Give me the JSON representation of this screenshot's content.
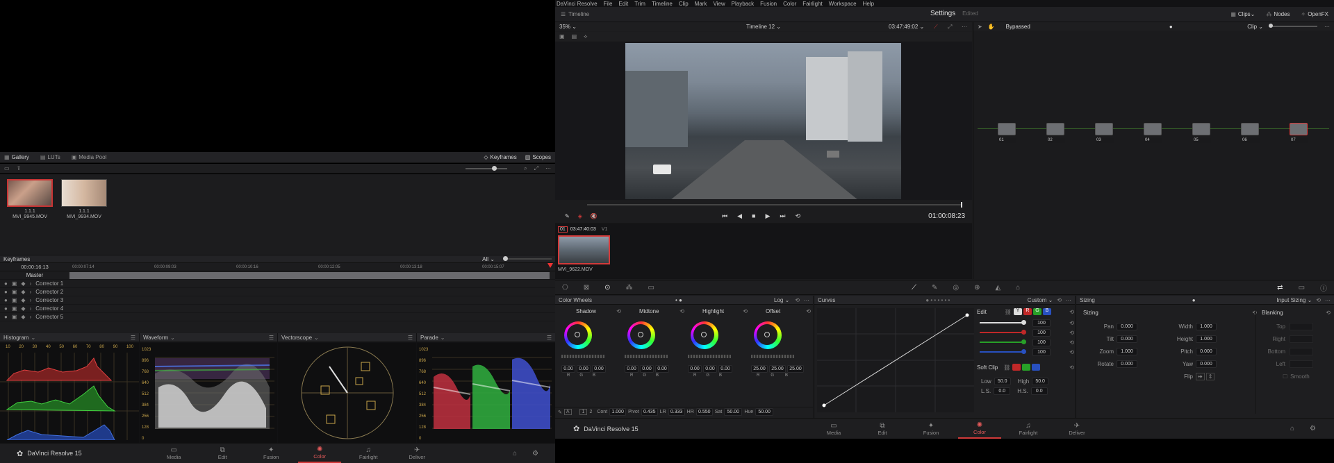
{
  "menu": {
    "items": [
      "DaVinci Resolve",
      "File",
      "Edit",
      "Trim",
      "Timeline",
      "Clip",
      "Mark",
      "View",
      "Playback",
      "Fusion",
      "Color",
      "Fairlight",
      "Workspace",
      "Help"
    ]
  },
  "header": {
    "timeline_label": "Timeline",
    "title": "Settings",
    "status": "Edited",
    "clips_label": "Clips",
    "nodes_label": "Nodes",
    "openfx_label": "OpenFX"
  },
  "viewer": {
    "zoom": "35%",
    "timeline_name": "Timeline 12",
    "timecode_top": "03:47:49:02",
    "timecode": "01:00:08:23"
  },
  "node_editor": {
    "status": "Bypassed",
    "mode": "Clip",
    "nodes": [
      "01",
      "02",
      "03",
      "04",
      "05",
      "06",
      "07"
    ]
  },
  "clip_strip": {
    "clip_number": "01",
    "clip_timecode": "03:47:40:03",
    "track": "V1",
    "clip_name": "MVI_9622.MOV"
  },
  "gallery": {
    "tabs": [
      "Gallery",
      "LUTs",
      "Media Pool"
    ],
    "right_tabs": [
      "Keyframes",
      "Scopes"
    ],
    "stills": [
      {
        "label": "1.1.1",
        "name": "MVI_9945.MOV"
      },
      {
        "label": "1.1.1",
        "name": "MVI_9934.MOV"
      }
    ]
  },
  "keyframes": {
    "title": "Keyframes",
    "filter": "All",
    "current_tc": "00:00:16:13",
    "ruler": [
      "00:00:07:14",
      "00:00:09:03",
      "00:00:10:16",
      "00:00:12:05",
      "00:00:13:18",
      "00:00:15:07"
    ],
    "rows": [
      "Master",
      "Corrector 1",
      "Corrector 2",
      "Corrector 3",
      "Corrector 4",
      "Corrector 5"
    ]
  },
  "scopes": {
    "panels": [
      "Histogram",
      "Waveform",
      "Vectorscope",
      "Parade"
    ],
    "histogram_ticks": [
      "10",
      "20",
      "30",
      "40",
      "50",
      "60",
      "70",
      "80",
      "90",
      "100"
    ],
    "waveform_ticks": [
      "1023",
      "896",
      "768",
      "640",
      "512",
      "384",
      "256",
      "128",
      "0"
    ],
    "parade_ticks": [
      "1023",
      "896",
      "768",
      "640",
      "512",
      "384",
      "256",
      "128",
      "0"
    ]
  },
  "color_wheels": {
    "title": "Color Wheels",
    "mode": "Log",
    "wheels": [
      {
        "name": "Shadow",
        "values": [
          "0.00",
          "0.00",
          "0.00"
        ]
      },
      {
        "name": "Midtone",
        "values": [
          "0.00",
          "0.00",
          "0.00"
        ]
      },
      {
        "name": "Highlight",
        "values": [
          "0.00",
          "0.00",
          "0.00"
        ]
      },
      {
        "name": "Offset",
        "values": [
          "25.00",
          "25.00",
          "25.00"
        ]
      }
    ],
    "channel_labels": [
      "R",
      "G",
      "B"
    ],
    "bottom": {
      "page1": "1",
      "page2": "2",
      "cont_label": "Cont",
      "cont": "1.000",
      "pivot_label": "Pivot",
      "pivot": "0.435",
      "lr_label": "LR",
      "lr": "0.333",
      "hr_label": "HR",
      "hr": "0.550",
      "sat_label": "Sat",
      "sat": "50.00",
      "hue_label": "Hue",
      "hue": "50.00"
    }
  },
  "curves": {
    "title": "Curves",
    "mode": "Custom",
    "edit_label": "Edit",
    "channels": [
      "Y",
      "R",
      "G",
      "B"
    ],
    "edit_values": [
      "100",
      "100",
      "100",
      "100"
    ],
    "soft_clip": "Soft Clip",
    "low_label": "Low",
    "low": "50.0",
    "high_label": "High",
    "high": "50.0",
    "ls_label": "L.S.",
    "ls": "0.0",
    "hs_label": "H.S.",
    "hs": "0.0"
  },
  "sizing": {
    "title": "Sizing",
    "mode": "Input Sizing",
    "section": "Sizing",
    "pan_label": "Pan",
    "pan": "0.000",
    "tilt_label": "Tilt",
    "tilt": "0.000",
    "zoom_label": "Zoom",
    "zoom": "1.000",
    "rotate_label": "Rotate",
    "rotate": "0.000",
    "width_label": "Width",
    "width": "1.000",
    "height_label": "Height",
    "height": "1.000",
    "pitch_label": "Pitch",
    "pitch": "0.000",
    "yaw_label": "Yaw",
    "yaw": "0.000",
    "flip_label": "Flip",
    "blanking": "Blanking",
    "top": "Top",
    "right": "Right",
    "bottom": "Bottom",
    "left": "Left",
    "smooth": "Smooth"
  },
  "bottom_bar": {
    "app_name": "DaVinci Resolve 15",
    "tabs": [
      "Media",
      "Edit",
      "Fusion",
      "Color",
      "Fairlight",
      "Deliver"
    ],
    "active": "Color"
  },
  "colors": {
    "accent": "#d23a3a",
    "panel": "#1c1c1e",
    "header": "#252528"
  }
}
